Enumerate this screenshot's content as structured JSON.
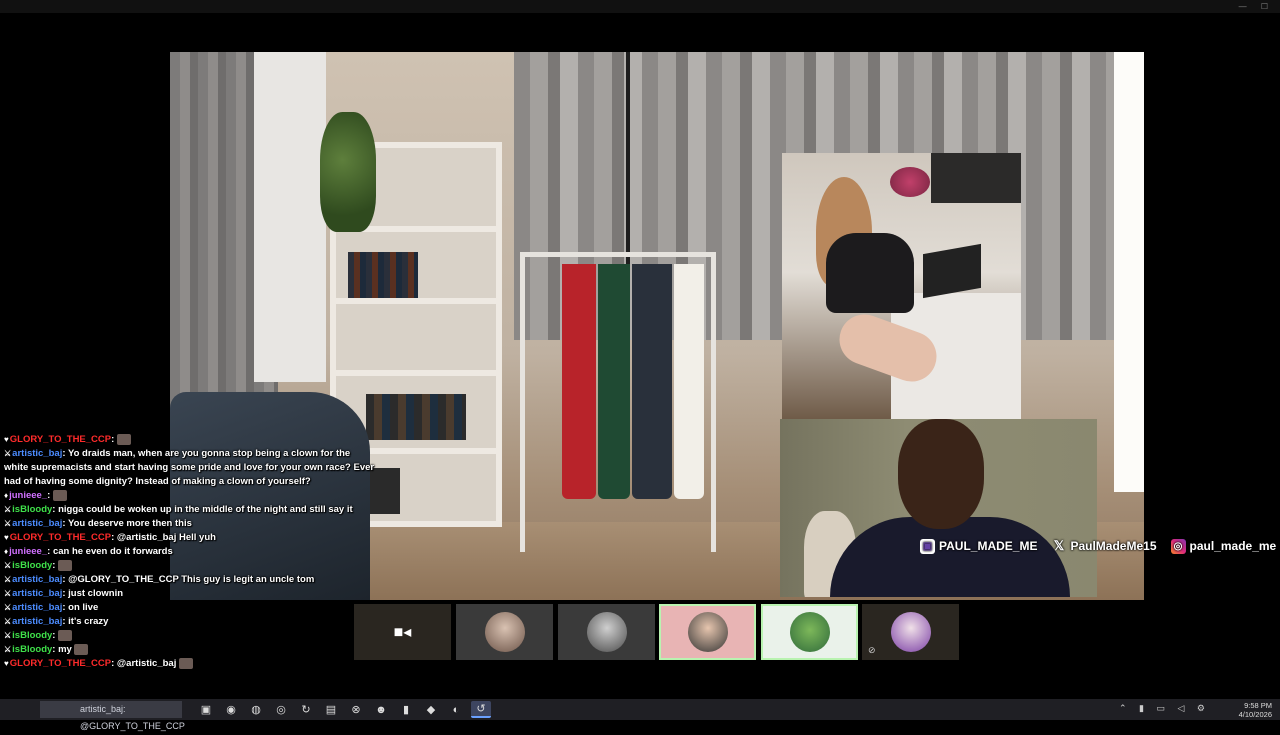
{
  "window": {
    "controls": "— ☐"
  },
  "stream": {
    "socials": {
      "twitch": "PAUL_MADE_ME",
      "x": "PaulMadeMe15",
      "instagram": "paul_made_me"
    }
  },
  "participants": [
    {
      "name": "camera",
      "icon": "camera-icon",
      "bg": "#2a2620"
    },
    {
      "name": "participant-2",
      "icon": "avatar",
      "bg": "#3a3a3a"
    },
    {
      "name": "participant-3",
      "icon": "avatar",
      "bg": "#3a3a3a"
    },
    {
      "name": "participant-4",
      "icon": "avatar",
      "bg": "#e8b4b4",
      "active": true
    },
    {
      "name": "participant-5",
      "icon": "pepe-avatar",
      "bg": "#eaf2ea",
      "active": true
    },
    {
      "name": "participant-6",
      "icon": "avatar",
      "bg": "#2a2620",
      "muted": true
    }
  ],
  "chat": {
    "messages": [
      {
        "badge": "♥",
        "user": "GLORY_TO_THE_CCP",
        "color": "red",
        "text": "",
        "emote": true
      },
      {
        "badge": "⚔",
        "user": "artistic_baj",
        "color": "blue",
        "text": "Yo draids man, when are you gonna stop being a clown for the white supremacists and start having some pride and love for your own race? Ever had of having some dignity? Instead of making a clown of yourself?"
      },
      {
        "badge": "♦",
        "user": "junieee_",
        "color": "purple",
        "text": "",
        "emote": true
      },
      {
        "badge": "⚔",
        "user": "isBloody",
        "color": "green",
        "text": "nigga could be woken up in the middle of the night and still say it"
      },
      {
        "badge": "⚔",
        "user": "artistic_baj",
        "color": "blue",
        "text": "You deserve more then this"
      },
      {
        "badge": "♥",
        "user": "GLORY_TO_THE_CCP",
        "color": "red",
        "text": "@artistic_baj Hell yuh"
      },
      {
        "badge": "♦",
        "user": "junieee_",
        "color": "purple",
        "text": "can he even do it forwards"
      },
      {
        "badge": "⚔",
        "user": "isBloody",
        "color": "green",
        "text": "",
        "emote": true
      },
      {
        "badge": "⚔",
        "user": "artistic_baj",
        "color": "blue",
        "text": "@GLORY_TO_THE_CCP This guy is legit an uncle tom"
      },
      {
        "badge": "⚔",
        "user": "artistic_baj",
        "color": "blue",
        "text": "just clownin"
      },
      {
        "badge": "⚔",
        "user": "artistic_baj",
        "color": "blue",
        "text": "on live"
      },
      {
        "badge": "⚔",
        "user": "artistic_baj",
        "color": "blue",
        "text": "it's crazy"
      },
      {
        "badge": "⚔",
        "user": "isBloody",
        "color": "green",
        "text": "",
        "emote": true
      },
      {
        "badge": "⚔",
        "user": "isBloody",
        "color": "green",
        "text": "my",
        "emote": true
      },
      {
        "badge": "♥",
        "user": "GLORY_TO_THE_CCP",
        "color": "red",
        "text": "@artistic_baj",
        "emote": true
      }
    ]
  },
  "taskbar": {
    "pinned_label": "artistic_baj: @GLORY_TO_THE_CCP",
    "icons": [
      {
        "name": "folder-icon",
        "glyph": "▣"
      },
      {
        "name": "browser-icon",
        "glyph": "◉"
      },
      {
        "name": "firefox-icon",
        "glyph": "◍"
      },
      {
        "name": "chrome-icon",
        "glyph": "◎"
      },
      {
        "name": "refresh-icon",
        "glyph": "↻"
      },
      {
        "name": "files-icon",
        "glyph": "▤"
      },
      {
        "name": "xbox-icon",
        "glyph": "⊗"
      },
      {
        "name": "discord-icon",
        "glyph": "☻"
      },
      {
        "name": "app-icon",
        "glyph": "▮"
      },
      {
        "name": "vscode-icon",
        "glyph": "◆"
      },
      {
        "name": "edge-icon",
        "glyph": "◐"
      },
      {
        "name": "app2-icon",
        "glyph": "↺",
        "active": true
      }
    ],
    "tray": "⌃ ▮ ▭ ◁ ⚙",
    "time": "9:58 PM",
    "date": "4/10/2026"
  }
}
